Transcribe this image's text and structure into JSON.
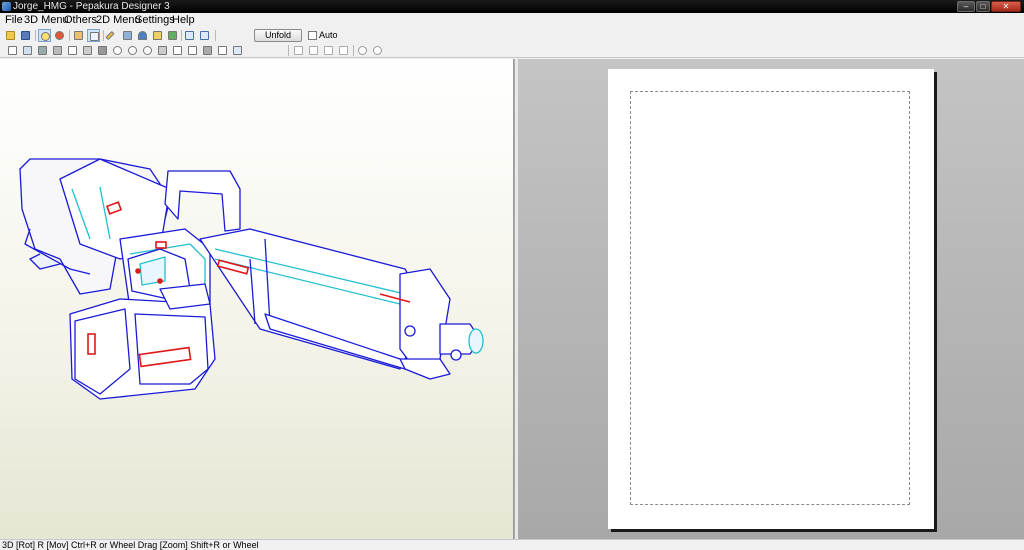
{
  "window": {
    "title": "Jorge_HMG - Pepakura Designer 3"
  },
  "menu": [
    "File",
    "3D Menu",
    "Others",
    "2D Menu",
    "Settings",
    "Help"
  ],
  "toolbar": {
    "unfold_label": "Unfold",
    "auto_label": "Auto",
    "auto_checked": false
  },
  "status": {
    "text": "3D [Rot] R [Mov] Ctrl+R or Wheel Drag [Zoom] Shift+R or Wheel"
  },
  "colors": {
    "model_edges": "#1a1ad8",
    "fold_lines": "#20c0d0",
    "highlight": "#e01818",
    "page_bg": "#a8a8a8"
  },
  "icons": {
    "toolbar1": [
      "open-icon",
      "save-icon",
      "light-icon",
      "texture-icon",
      "unfold-model-icon",
      "select-face-icon",
      "pencil-icon",
      "cube-icon",
      "anchor-icon",
      "flap-icon",
      "lock-icon",
      "window-single-icon",
      "window-split-icon"
    ],
    "toolbar2": [
      "print-icon",
      "edit-edge-icon",
      "image-icon",
      "flaps-icon",
      "page-icon",
      "join-icon",
      "rotate-icon",
      "zoom-icon",
      "undo-icon",
      "redo-icon",
      "part-icon",
      "align-left-icon",
      "align-center-icon",
      "align-right-icon",
      "align-middle-icon",
      "zoom-in-icon",
      "zoom-out-icon"
    ]
  }
}
